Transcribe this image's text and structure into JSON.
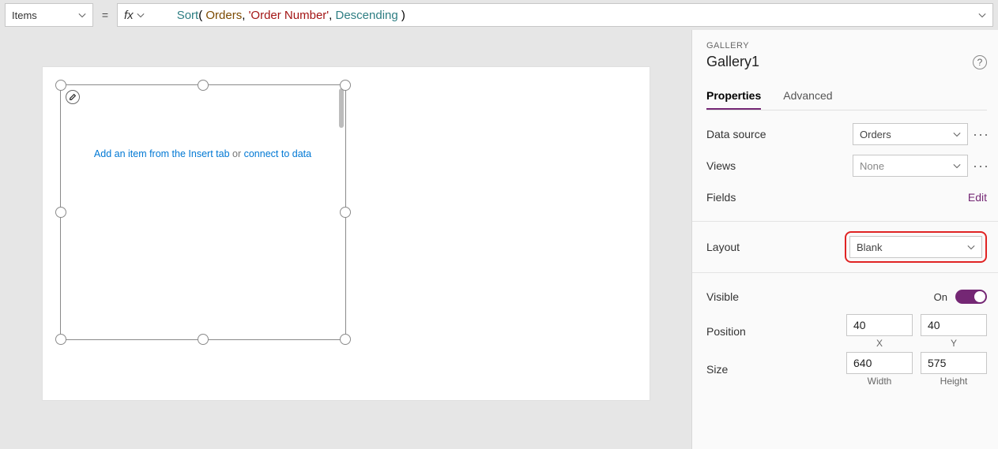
{
  "formulaBar": {
    "property": "Items",
    "fxLabel": "fx",
    "tokens": {
      "func": "Sort",
      "open": "( ",
      "ident": "Orders",
      "c1": ", ",
      "str": "'Order Number'",
      "c2": ", ",
      "kw": "Descending",
      "close": " )"
    }
  },
  "canvas": {
    "hintPrimary": "Add an item from the Insert tab",
    "hintMid": " or ",
    "hintSecondary": "connect to data"
  },
  "panel": {
    "type": "GALLERY",
    "name": "Gallery1",
    "tabs": {
      "properties": "Properties",
      "advanced": "Advanced"
    },
    "labels": {
      "dataSource": "Data source",
      "views": "Views",
      "fields": "Fields",
      "editLink": "Edit",
      "layout": "Layout",
      "visible": "Visible",
      "visibleState": "On",
      "position": "Position",
      "size": "Size",
      "x": "X",
      "y": "Y",
      "width": "Width",
      "height": "Height"
    },
    "values": {
      "dataSource": "Orders",
      "views": "None",
      "layout": "Blank",
      "posX": "40",
      "posY": "40",
      "sizeW": "640",
      "sizeH": "575"
    }
  }
}
